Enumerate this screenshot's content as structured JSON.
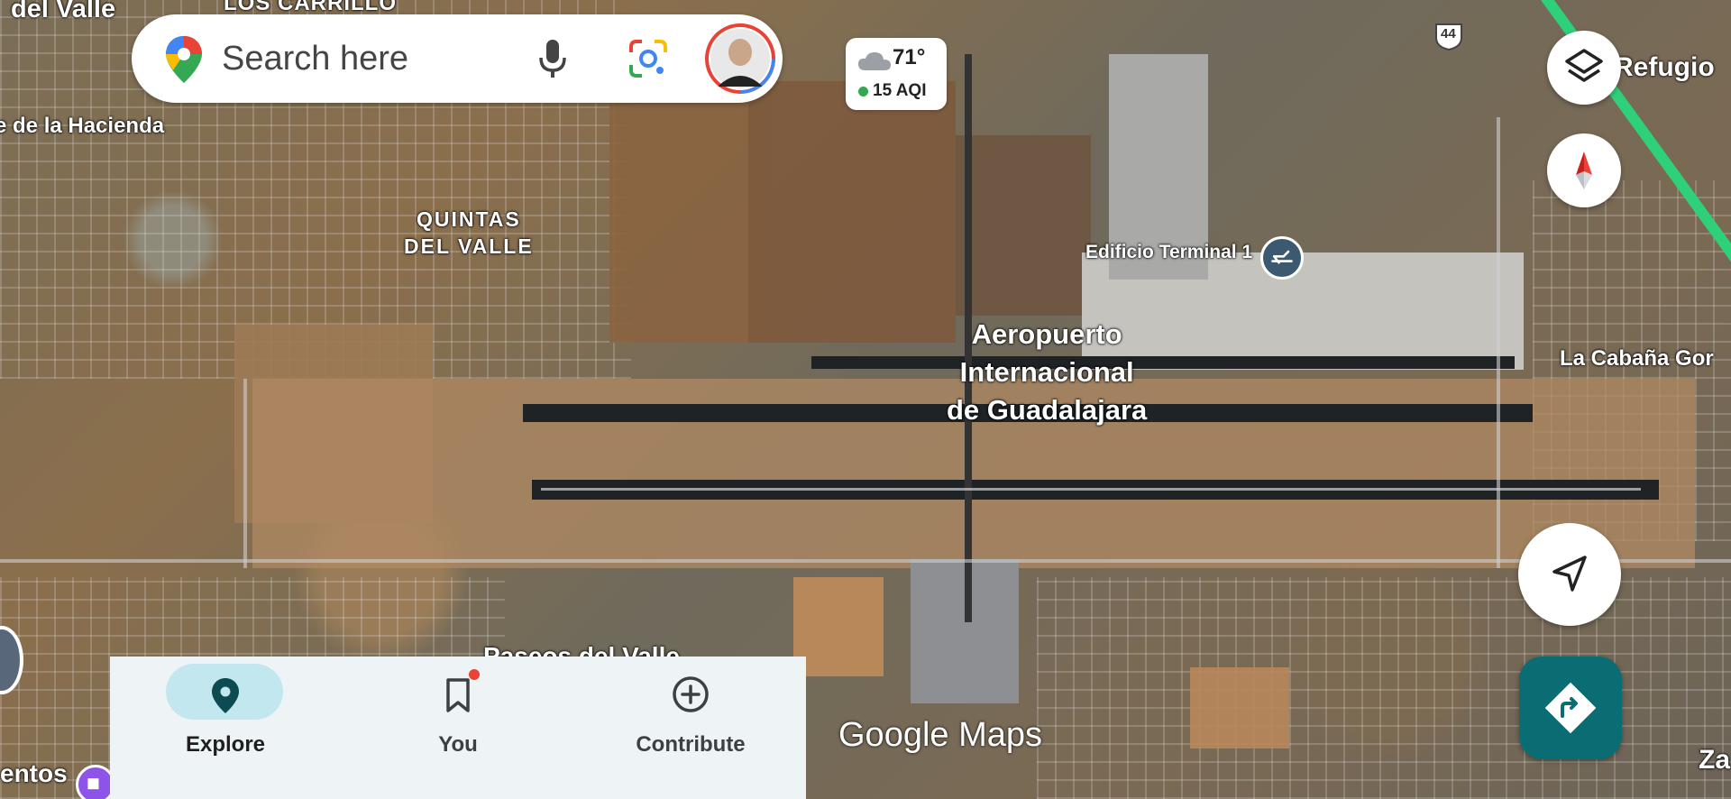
{
  "search": {
    "placeholder": "Search here"
  },
  "weather": {
    "temperature": "71°",
    "aqi": "15 AQI"
  },
  "map_labels": {
    "del_valle": "del Valle",
    "los_carrillo": "LOS CARRILLO",
    "de_la_hacienda": "e de la Hacienda",
    "quintas_del_valle": "QUINTAS\nDEL VALLE",
    "refugio": "Refugio",
    "edificio_terminal": "Edificio Terminal 1",
    "airport": "Aeropuerto\nInternacional\nde Guadalajara",
    "la_cabana": "La Cabaña Gor",
    "paseos_del_valle": "Paseos del Valle",
    "ventos": "entos",
    "za": "Za",
    "highway_number": "44"
  },
  "watermark": "Google Maps",
  "bottom_nav": {
    "items": [
      {
        "label": "Explore",
        "icon": "location-pin-icon",
        "active": true
      },
      {
        "label": "You",
        "icon": "bookmark-icon",
        "active": false,
        "notification_badge": true
      },
      {
        "label": "Contribute",
        "icon": "add-circle-icon",
        "active": false
      }
    ]
  },
  "colors": {
    "nav_active_pill": "#c2e7ee",
    "directions_button": "#0b6d74",
    "highway": "#2fd07a",
    "aqi_good": "#34a853"
  }
}
